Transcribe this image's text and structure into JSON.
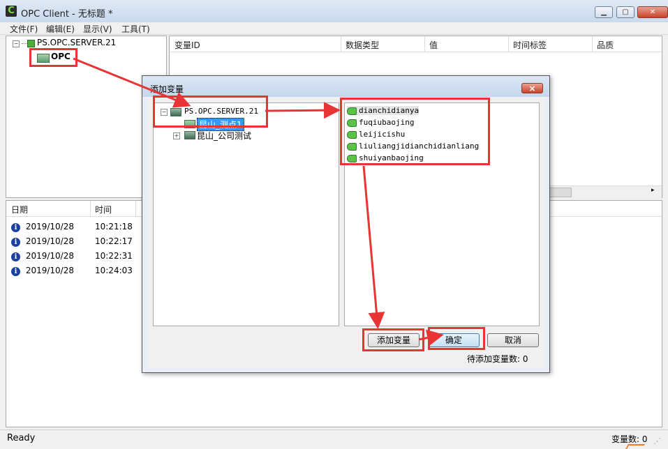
{
  "window": {
    "title": "OPC Client - 无标题 *",
    "icon_letter": "C"
  },
  "menu": [
    "文件(F)",
    "编辑(E)",
    "显示(V)",
    "工具(T)"
  ],
  "tree": {
    "server": "PS.OPC.SERVER.21",
    "node": "OPC"
  },
  "list": {
    "columns": [
      "变量ID",
      "数据类型",
      "值",
      "时间标签",
      "品质"
    ]
  },
  "log": {
    "columns": [
      "日期",
      "时间"
    ],
    "rows": [
      {
        "date": "2019/10/28",
        "time": "10:21:18"
      },
      {
        "date": "2019/10/28",
        "time": "10:22:17"
      },
      {
        "date": "2019/10/28",
        "time": "10:22:31"
      },
      {
        "date": "2019/10/28",
        "time": "10:24:03"
      }
    ]
  },
  "status": {
    "ready": "Ready",
    "count_label": "变量数: 0"
  },
  "dialog": {
    "title": "添加变量",
    "close": "×",
    "tree": {
      "server": "PS.OPC.SERVER.21",
      "groups": [
        "昆山_测点1",
        "昆山_公司测试"
      ]
    },
    "variables": [
      "dianchidianya",
      "fuqiubaojing",
      "leijicishu",
      "liuliangjidianchidianliang",
      "shuiyanbaojing"
    ],
    "buttons": {
      "add": "添加变量",
      "ok": "确定",
      "cancel": "取消"
    },
    "pending_label": "待添加变量数: 0"
  },
  "colors": {
    "annotation_red": "#e83434",
    "selection_blue": "#3399ff"
  }
}
